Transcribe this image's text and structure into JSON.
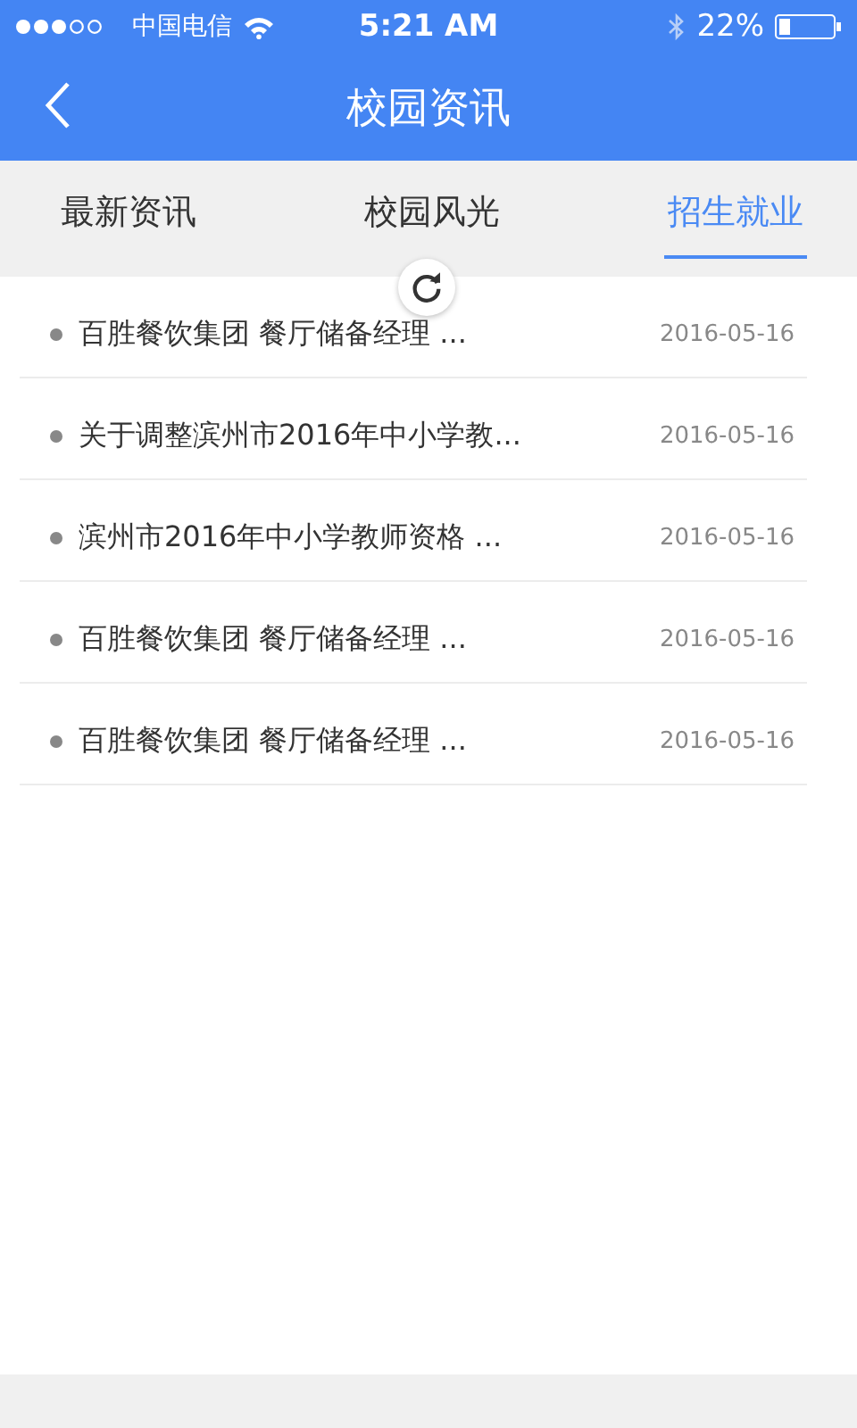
{
  "status_bar": {
    "carrier": "中国电信",
    "time": "5:21 AM",
    "battery": "22%"
  },
  "nav": {
    "title": "校园资讯"
  },
  "tabs": [
    {
      "label": "最新资讯",
      "selected": false
    },
    {
      "label": "校园风光",
      "selected": false
    },
    {
      "label": "招生就业",
      "selected": true
    }
  ],
  "news": [
    {
      "title": "百胜餐饮集团 餐厅储备经理 ...",
      "date": "2016-05-16"
    },
    {
      "title": "关于调整滨州市2016年中小学教...",
      "date": "2016-05-16"
    },
    {
      "title": "滨州市2016年中小学教师资格 ...",
      "date": "2016-05-16"
    },
    {
      "title": "百胜餐饮集团 餐厅储备经理 ...",
      "date": "2016-05-16"
    },
    {
      "title": "百胜餐饮集团 餐厅储备经理 ...",
      "date": "2016-05-16"
    }
  ]
}
